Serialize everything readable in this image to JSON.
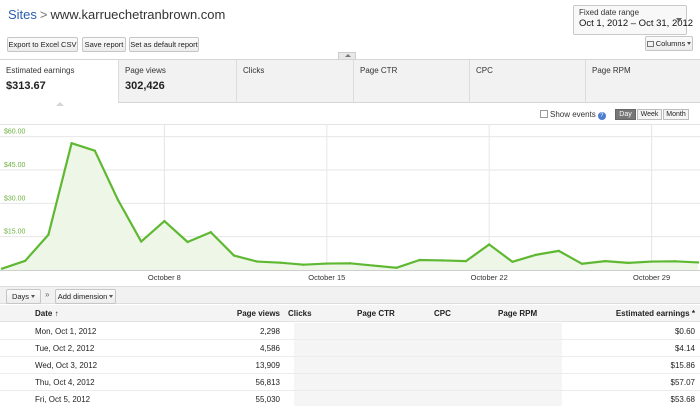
{
  "header": {
    "breadcrumb_root": "Sites",
    "breadcrumb_sep": ">",
    "site": "www.karruechetranbrown.com",
    "date_range_label": "Fixed date range",
    "date_range_value": "Oct 1, 2012 – Oct 31, 2012"
  },
  "toolbar": {
    "export_label": "Export to Excel CSV",
    "save_label": "Save report",
    "default_label": "Set as default report",
    "columns_label": "Columns"
  },
  "metrics": [
    {
      "label": "Estimated earnings",
      "value": "$313.67"
    },
    {
      "label": "Page views",
      "value": "302,426"
    },
    {
      "label": "Clicks",
      "value": ""
    },
    {
      "label": "Page CTR",
      "value": ""
    },
    {
      "label": "CPC",
      "value": ""
    },
    {
      "label": "Page RPM",
      "value": ""
    }
  ],
  "chart_controls": {
    "show_events": "Show events",
    "help": "?",
    "granularity": [
      "Day",
      "Week",
      "Month"
    ],
    "selected": "Day"
  },
  "colors": {
    "line": "#5fb832",
    "fill": "#eef7e7",
    "grid": "#e6e6e6",
    "axis_text": "#6cb33f"
  },
  "chart_data": {
    "type": "area",
    "x": [
      "Oct 1",
      "Oct 2",
      "Oct 3",
      "Oct 4",
      "Oct 5",
      "Oct 6",
      "Oct 7",
      "Oct 8",
      "Oct 9",
      "Oct 10",
      "Oct 11",
      "Oct 12",
      "Oct 13",
      "Oct 14",
      "Oct 15",
      "Oct 16",
      "Oct 17",
      "Oct 18",
      "Oct 19",
      "Oct 20",
      "Oct 21",
      "Oct 22",
      "Oct 23",
      "Oct 24",
      "Oct 25",
      "Oct 26",
      "Oct 27",
      "Oct 28",
      "Oct 29",
      "Oct 30",
      "Oct 31"
    ],
    "series": [
      {
        "values": [
          0.6,
          4.14,
          15.86,
          57.07,
          53.68,
          31.5,
          12.8,
          22.0,
          12.6,
          17.0,
          6.5,
          3.8,
          3.3,
          2.4,
          2.9,
          3.0,
          2.0,
          1.0,
          4.5,
          4.3,
          4.0,
          11.5,
          3.7,
          6.8,
          8.6,
          2.8,
          4.0,
          3.2,
          3.8,
          3.9,
          3.4
        ]
      }
    ],
    "yticks": [
      "$15.00",
      "$30.00",
      "$45.00",
      "$60.00"
    ],
    "ytick_values": [
      15,
      30,
      45,
      60
    ],
    "ylim": [
      0,
      63
    ],
    "xticks": [
      "October 8",
      "October 15",
      "October 22",
      "October 29"
    ],
    "xtick_index": [
      7,
      14,
      21,
      28
    ]
  },
  "table_toolbar": {
    "days_label": "Days",
    "double_arrow": "»",
    "add_dimension_label": "Add dimension"
  },
  "table": {
    "columns": [
      "Date",
      "Page views",
      "Clicks",
      "Page CTR",
      "CPC",
      "Page RPM",
      "Estimated earnings"
    ],
    "sort_indicator": "↑",
    "sort_indicator_right": "*",
    "rows": [
      {
        "date": "Mon, Oct 1, 2012",
        "views": "2,298",
        "earnings": "$0.60"
      },
      {
        "date": "Tue, Oct 2, 2012",
        "views": "4,586",
        "earnings": "$4.14"
      },
      {
        "date": "Wed, Oct 3, 2012",
        "views": "13,909",
        "earnings": "$15.86"
      },
      {
        "date": "Thu, Oct 4, 2012",
        "views": "56,813",
        "earnings": "$57.07"
      },
      {
        "date": "Fri, Oct 5, 2012",
        "views": "55,030",
        "earnings": "$53.68"
      }
    ]
  }
}
